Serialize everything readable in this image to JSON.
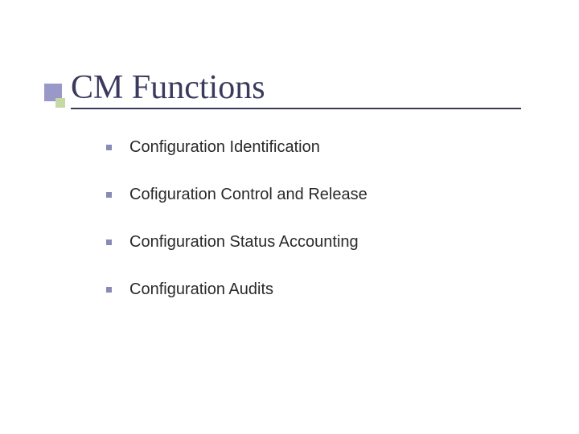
{
  "slide": {
    "title": "CM Functions",
    "bullets": [
      {
        "text": "Configuration Identification"
      },
      {
        "text": "Cofiguration Control and Release"
      },
      {
        "text": "Configuration Status Accounting"
      },
      {
        "text": "Configuration Audits"
      }
    ]
  }
}
